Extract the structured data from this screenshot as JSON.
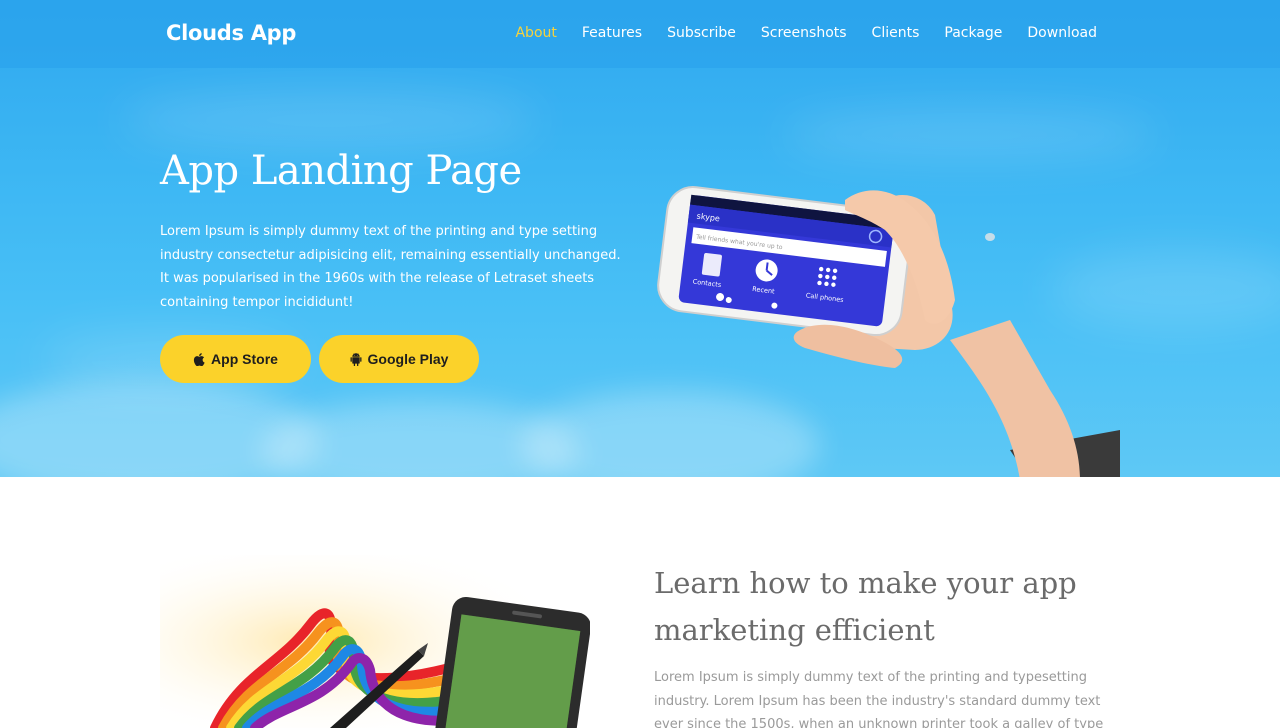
{
  "header": {
    "brand": "Clouds App",
    "nav": [
      {
        "label": "About",
        "active": true
      },
      {
        "label": "Features"
      },
      {
        "label": "Subscribe"
      },
      {
        "label": "Screenshots"
      },
      {
        "label": "Clients"
      },
      {
        "label": "Package"
      },
      {
        "label": "Download"
      }
    ]
  },
  "hero": {
    "title": "App Landing Page",
    "text": "Lorem Ipsum is simply dummy text of the printing and type setting industry consectetur adipisicing elit, remaining essentially unchanged. It was popularised in the 1960s with the release of Letraset sheets containing tempor incididunt!",
    "buttons": {
      "app_store": {
        "label": "App Store",
        "icon": "apple-icon"
      },
      "google_play": {
        "label": "Google Play",
        "icon": "android-icon"
      }
    },
    "phone_screen": {
      "app_name": "skype",
      "placeholder": "Tell friends what you're up to",
      "tiles": [
        "Contacts",
        "Recent",
        "Call phones"
      ]
    }
  },
  "section2": {
    "title": "Learn how to make your app marketing efficient",
    "text": "Lorem Ipsum is simply dummy text of the printing and typesetting industry. Lorem Ipsum has been the industry's standard dummy text ever since the 1500s, when an unknown printer took a galley of type and scrambled it to"
  },
  "colors": {
    "accent": "#fbd22a",
    "active_nav": "#f7d23c",
    "sky": "#3cb6f3"
  }
}
